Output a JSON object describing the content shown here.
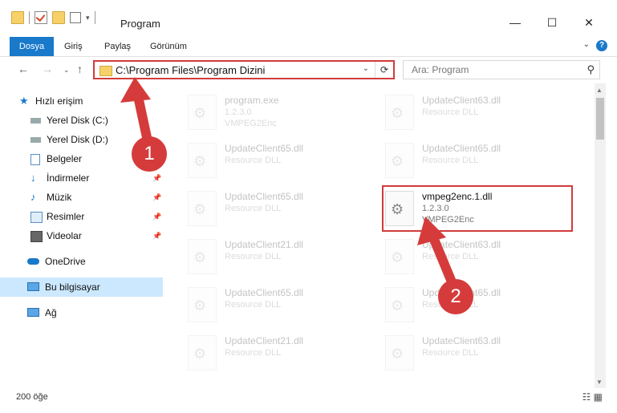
{
  "window": {
    "title": "Program",
    "controls": {
      "minimize": "—",
      "maximize": "☐",
      "close": "✕"
    }
  },
  "ribbon": {
    "tabs": [
      "Dosya",
      "Giriş",
      "Paylaş",
      "Görünüm"
    ],
    "help_label": "?"
  },
  "address_bar": {
    "path": "C:\\Program Files\\Program Dizini",
    "refresh_icon": "⟳"
  },
  "search": {
    "placeholder": "Ara: Program"
  },
  "sidebar": {
    "quick_access": "Hızlı erişim",
    "items": [
      {
        "label": "Yerel Disk (C:)",
        "icon": "drive-icon"
      },
      {
        "label": "Yerel Disk (D:)",
        "icon": "drive-icon"
      },
      {
        "label": "Belgeler",
        "icon": "documents-icon"
      },
      {
        "label": "İndirmeler",
        "icon": "downloads-icon"
      },
      {
        "label": "Müzik",
        "icon": "music-icon"
      },
      {
        "label": "Resimler",
        "icon": "pictures-icon"
      },
      {
        "label": "Videolar",
        "icon": "videos-icon"
      }
    ],
    "onedrive": "OneDrive",
    "this_pc": "Bu bilgisayar",
    "network": "Ağ"
  },
  "files": [
    {
      "name": "program.exe",
      "line1": "1.2.3.0",
      "line2": "VMPEG2Enc"
    },
    {
      "name": "UpdateClient63.dll",
      "line1": "Resource DLL",
      "line2": ""
    },
    {
      "name": "UpdateClient65.dll",
      "line1": "Resource DLL",
      "line2": ""
    },
    {
      "name": "UpdateClient65.dll",
      "line1": "Resource DLL",
      "line2": ""
    },
    {
      "name": "UpdateClient65.dll",
      "line1": "Resource DLL",
      "line2": ""
    },
    {
      "name": "vmpeg2enc.1.dll",
      "line1": "1.2.3.0",
      "line2": "VMPEG2Enc"
    },
    {
      "name": "UpdateClient21.dll",
      "line1": "Resource DLL",
      "line2": ""
    },
    {
      "name": "UpdateClient63.dll",
      "line1": "Resource DLL",
      "line2": ""
    },
    {
      "name": "UpdateClient65.dll",
      "line1": "Resource DLL",
      "line2": ""
    },
    {
      "name": "UpdateClient65.dll",
      "line1": "Resource DLL",
      "line2": ""
    },
    {
      "name": "UpdateClient21.dll",
      "line1": "Resource DLL",
      "line2": ""
    },
    {
      "name": "UpdateClient63.dll",
      "line1": "Resource DLL",
      "line2": ""
    }
  ],
  "status_bar": {
    "item_count": "200 öğe"
  },
  "annotations": {
    "step1": "1",
    "step2": "2"
  },
  "colors": {
    "accent": "#1979ca",
    "highlight_border": "#d23b3b",
    "callout": "#d63b3b",
    "selected_nav": "#cce8ff"
  }
}
